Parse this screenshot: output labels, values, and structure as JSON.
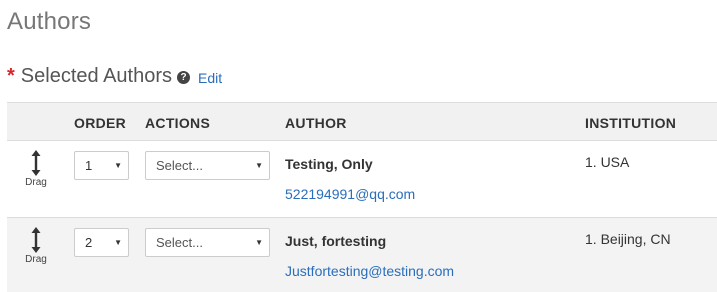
{
  "page_title": "Authors",
  "section": {
    "required_mark": "*",
    "title": "Selected Authors",
    "help_icon": "?",
    "edit_label": "Edit"
  },
  "table": {
    "headers": {
      "order": "ORDER",
      "actions": "ACTIONS",
      "author": "AUTHOR",
      "institution": "INSTITUTION"
    },
    "drag_label": "Drag",
    "rows": [
      {
        "order": "1",
        "action": "Select...",
        "author_name": "Testing, Only",
        "author_email": "522194991@qq.com",
        "institution": "1. USA"
      },
      {
        "order": "2",
        "action": "Select...",
        "author_name": "Just, fortesting",
        "author_email": "Justfortesting@testing.com",
        "institution": "1. Beijing, CN"
      }
    ]
  },
  "icons": {
    "drag": "vertical-double-arrow-icon",
    "help": "question-circle-icon",
    "caret": "caret-down-icon"
  },
  "colors": {
    "link": "#2a6ebb",
    "required": "#d9262c",
    "header_bg": "#f1f1f1",
    "alt_row_bg": "#f3f3f3"
  }
}
